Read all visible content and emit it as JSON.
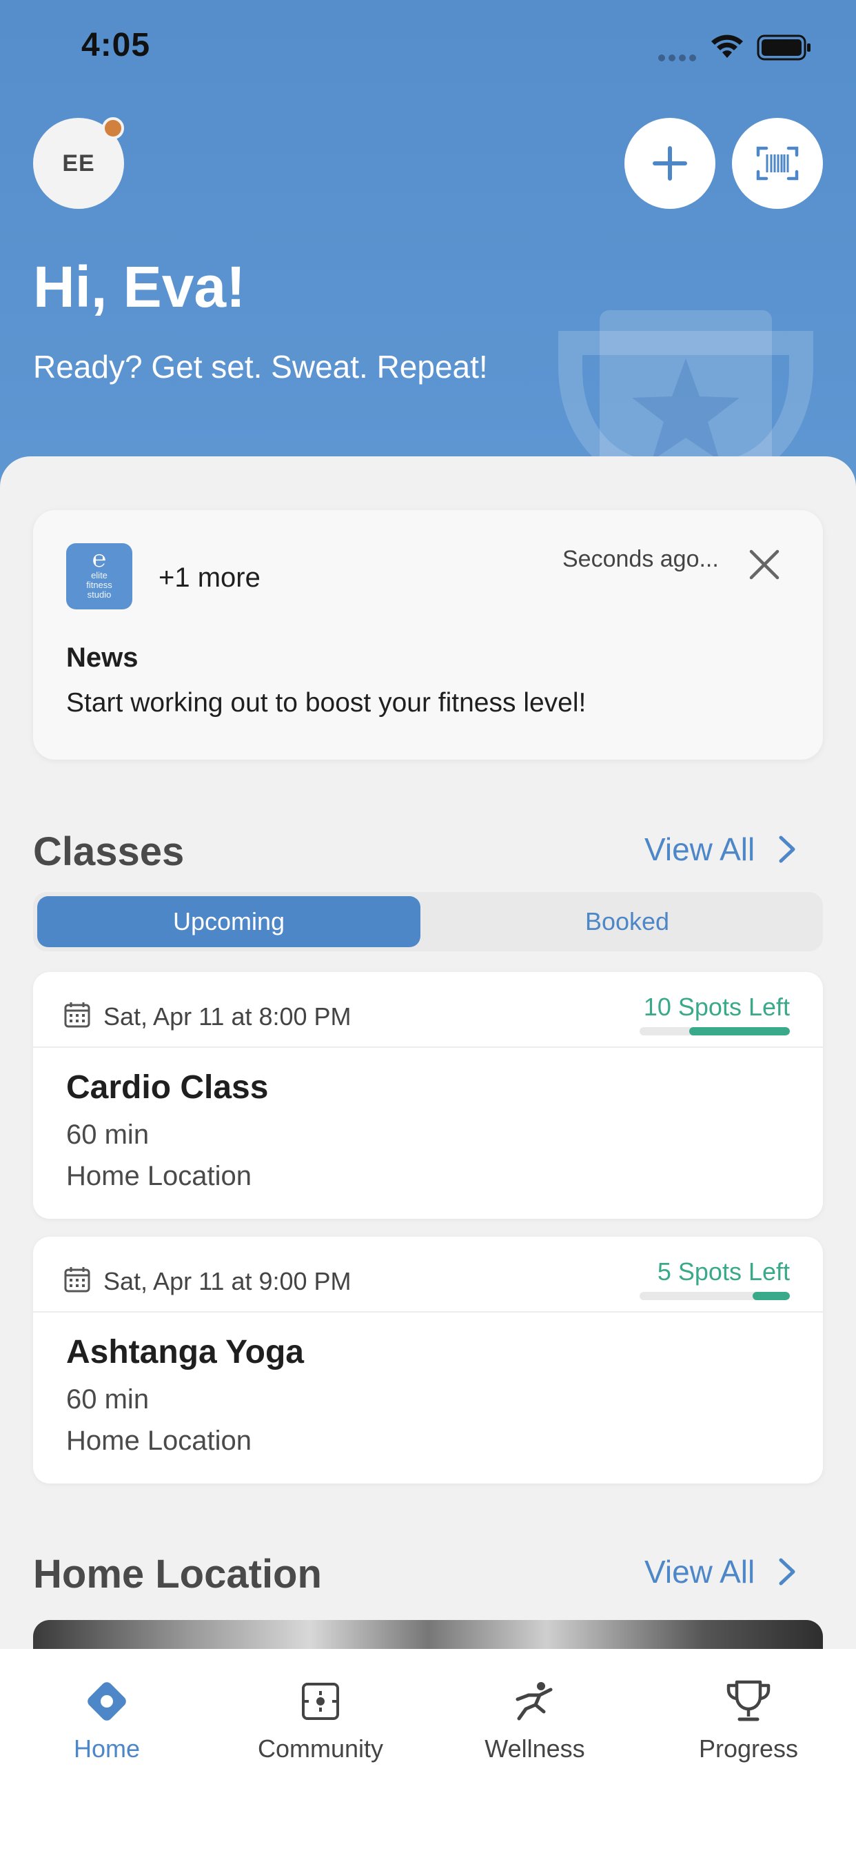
{
  "status_bar": {
    "time": "4:05"
  },
  "header": {
    "avatar_initials": "EE",
    "greeting": "Hi, Eva!",
    "tagline": "Ready? Get set. Sweat. Repeat!"
  },
  "news": {
    "logo_text": "elite fitness studio",
    "more_label": "+1 more",
    "time": "Seconds ago...",
    "title": "News",
    "body": "Start working out to boost your fitness level!"
  },
  "classes": {
    "title": "Classes",
    "view_all": "View All",
    "tabs": {
      "upcoming": "Upcoming",
      "booked": "Booked"
    },
    "items": [
      {
        "date": "Sat, Apr 11 at 8:00 PM",
        "spots": "10 Spots Left",
        "spots_fraction": 0.67,
        "name": "Cardio Class",
        "duration": "60 min",
        "location": "Home Location"
      },
      {
        "date": "Sat, Apr 11 at 9:00 PM",
        "spots": "5 Spots Left",
        "spots_fraction": 0.25,
        "name": "Ashtanga Yoga",
        "duration": "60 min",
        "location": "Home Location"
      }
    ]
  },
  "home_location": {
    "title": "Home Location",
    "view_all": "View All"
  },
  "tabbar": {
    "home": "Home",
    "community": "Community",
    "wellness": "Wellness",
    "progress": "Progress"
  },
  "colors": {
    "brand_blue": "#4d87c7",
    "header_blue": "#558ecb",
    "spots_green": "#3aa98a",
    "notification_dot": "#d2803d"
  }
}
